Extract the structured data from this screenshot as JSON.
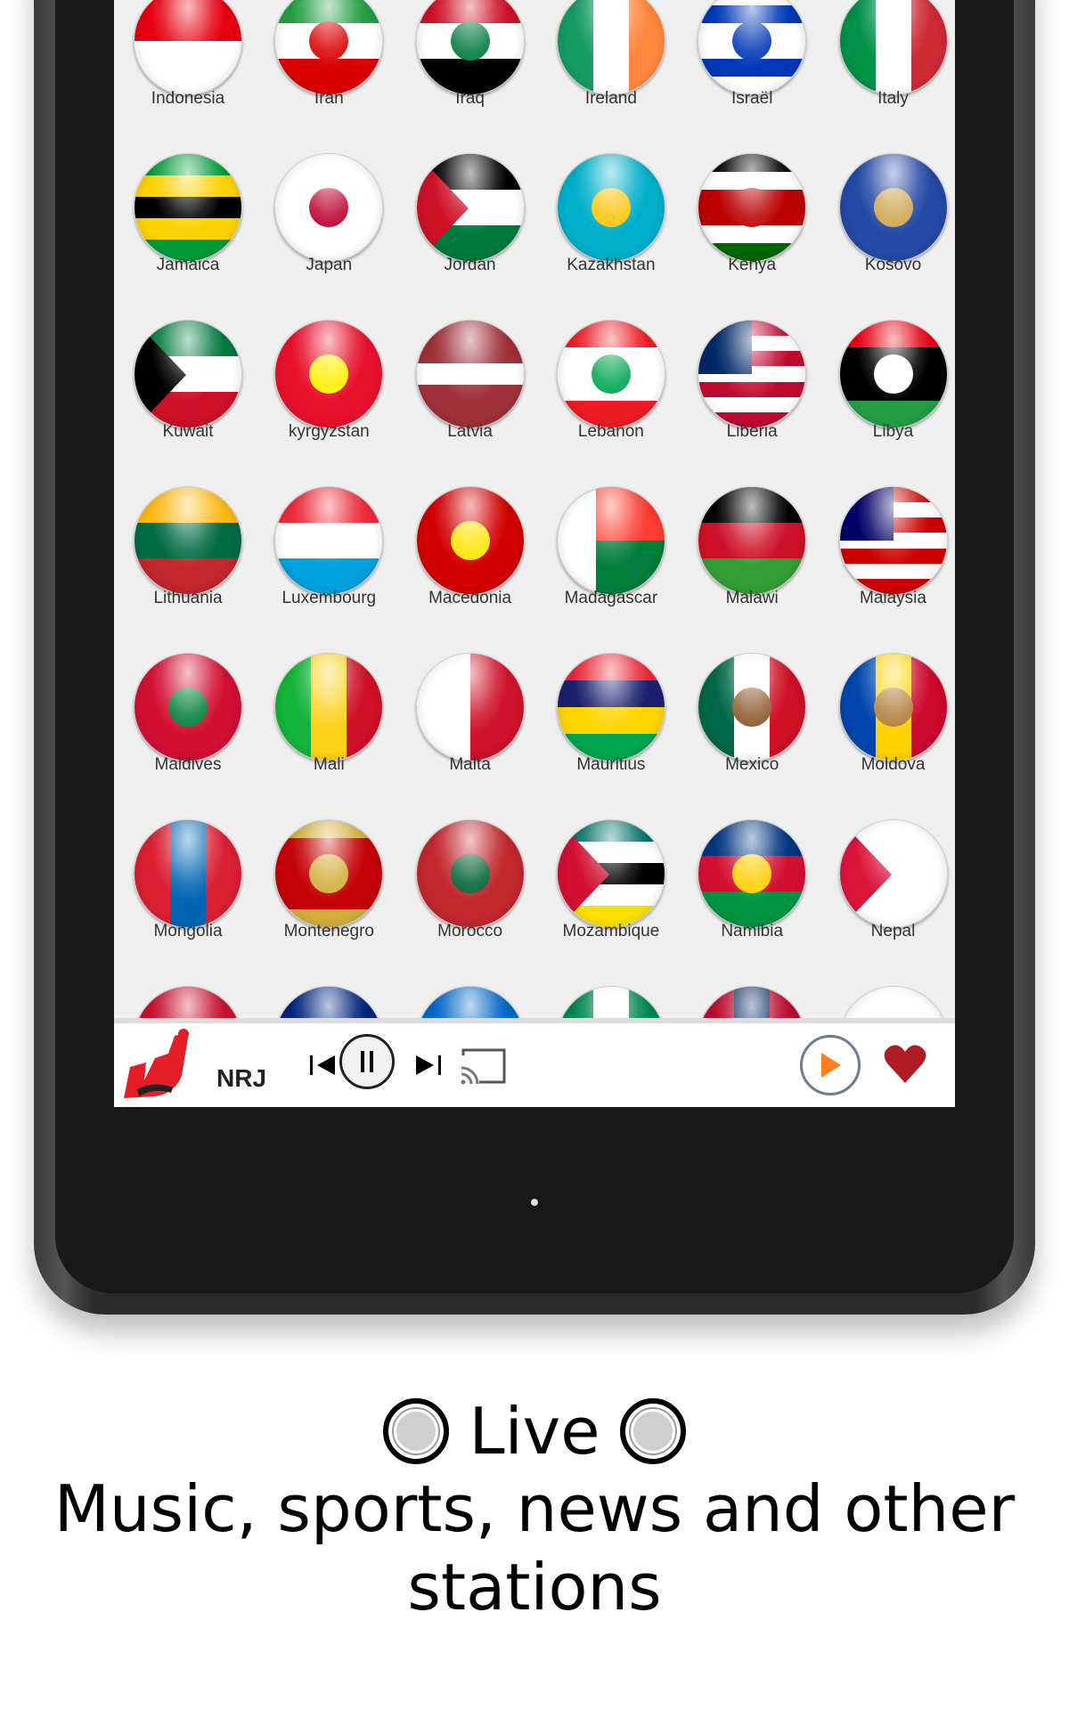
{
  "countries": [
    {
      "name": "Indonesia",
      "dir": "column",
      "stripes": [
        "#e70011",
        "#ffffff"
      ]
    },
    {
      "name": "Iran",
      "dir": "column",
      "stripes": [
        "#239f40",
        "#ffffff",
        "#da0000"
      ],
      "emblem": "#da0000"
    },
    {
      "name": "Iraq",
      "dir": "column",
      "stripes": [
        "#ce1126",
        "#ffffff",
        "#000000"
      ],
      "emblem": "#007a3d"
    },
    {
      "name": "Ireland",
      "dir": "row",
      "stripes": [
        "#169b62",
        "#ffffff",
        "#ff883e"
      ]
    },
    {
      "name": "Israël",
      "dir": "column",
      "stripes": [
        "#ffffff",
        "#0038b8",
        "#ffffff",
        "#ffffff",
        "#0038b8",
        "#ffffff"
      ],
      "emblem": "#0038b8"
    },
    {
      "name": "Italy",
      "dir": "row",
      "stripes": [
        "#009246",
        "#ffffff",
        "#ce2b37"
      ]
    },
    {
      "name": "Jamaica",
      "dir": "column",
      "stripes": [
        "#009b3a",
        "#fed100",
        "#000000",
        "#fed100",
        "#009b3a"
      ]
    },
    {
      "name": "Japan",
      "dir": "column",
      "stripes": [
        "#ffffff"
      ],
      "emblem": "#bc002d"
    },
    {
      "name": "Jordan",
      "dir": "column",
      "stripes": [
        "#000000",
        "#ffffff",
        "#007a3d"
      ],
      "tri": "#ce1126"
    },
    {
      "name": "Kazakhstan",
      "dir": "column",
      "stripes": [
        "#00afca"
      ],
      "emblem": "#fec50c"
    },
    {
      "name": "Kenya",
      "dir": "column",
      "stripes": [
        "#000000",
        "#ffffff",
        "#bb0000",
        "#bb0000",
        "#ffffff",
        "#006600"
      ],
      "emblem": "#bb0000"
    },
    {
      "name": "Kosovo",
      "dir": "column",
      "stripes": [
        "#244aa5"
      ],
      "emblem": "#d0a650"
    },
    {
      "name": "Kuwait",
      "dir": "column",
      "stripes": [
        "#007a3d",
        "#ffffff",
        "#ce1126"
      ],
      "tri": "#000000"
    },
    {
      "name": "kyrgyzstan",
      "dir": "column",
      "stripes": [
        "#e8112d"
      ],
      "emblem": "#ffef00"
    },
    {
      "name": "Latvia",
      "dir": "column",
      "stripes": [
        "#9e3039",
        "#9e3039",
        "#ffffff",
        "#9e3039",
        "#9e3039"
      ]
    },
    {
      "name": "Lebanon",
      "dir": "column",
      "stripes": [
        "#ed1c24",
        "#ffffff",
        "#ffffff",
        "#ed1c24"
      ],
      "emblem": "#00a651"
    },
    {
      "name": "Liberia",
      "dir": "column",
      "stripes": [
        "#bf0a30",
        "#ffffff",
        "#bf0a30",
        "#ffffff",
        "#bf0a30",
        "#ffffff",
        "#bf0a30"
      ],
      "canton": "#002868"
    },
    {
      "name": "Libya",
      "dir": "column",
      "stripes": [
        "#e70013",
        "#000000",
        "#000000",
        "#239e46"
      ],
      "emblem": "#ffffff"
    },
    {
      "name": "Lithuania",
      "dir": "column",
      "stripes": [
        "#fdb913",
        "#006a44",
        "#c1272d"
      ]
    },
    {
      "name": "Luxembourg",
      "dir": "column",
      "stripes": [
        "#ed2939",
        "#ffffff",
        "#00a1de"
      ]
    },
    {
      "name": "Macedonia",
      "dir": "column",
      "stripes": [
        "#d20000"
      ],
      "emblem": "#ffe600"
    },
    {
      "name": "Madagascar",
      "dir": "column",
      "stripes": [
        "#fc3d32",
        "#007e3a"
      ],
      "hoist": "#ffffff"
    },
    {
      "name": "Malawi",
      "dir": "column",
      "stripes": [
        "#000000",
        "#ce1126",
        "#339e35"
      ]
    },
    {
      "name": "Malaysia",
      "dir": "column",
      "stripes": [
        "#cc0001",
        "#ffffff",
        "#cc0001",
        "#ffffff",
        "#cc0001",
        "#ffffff",
        "#cc0001"
      ],
      "canton": "#010066"
    },
    {
      "name": "Maldives",
      "dir": "column",
      "stripes": [
        "#d21034"
      ],
      "emblem": "#007e3a"
    },
    {
      "name": "Mali",
      "dir": "row",
      "stripes": [
        "#14b53a",
        "#fcd116",
        "#ce1126"
      ]
    },
    {
      "name": "Malta",
      "dir": "row",
      "stripes": [
        "#ffffff",
        "#cf142b"
      ]
    },
    {
      "name": "Mauritius",
      "dir": "column",
      "stripes": [
        "#ea2839",
        "#1a206d",
        "#ffd500",
        "#00a551"
      ]
    },
    {
      "name": "Mexico",
      "dir": "row",
      "stripes": [
        "#006847",
        "#ffffff",
        "#ce1126"
      ],
      "emblem": "#8b5a2b"
    },
    {
      "name": "Moldova",
      "dir": "row",
      "stripes": [
        "#0046ae",
        "#ffd200",
        "#cc092f"
      ],
      "emblem": "#b07e3a"
    },
    {
      "name": "Mongolia",
      "dir": "row",
      "stripes": [
        "#da2032",
        "#0066b3",
        "#da2032"
      ]
    },
    {
      "name": "Montenegro",
      "dir": "column",
      "stripes": [
        "#d3ae3b",
        "#c40308",
        "#c40308",
        "#c40308",
        "#c40308",
        "#d3ae3b"
      ],
      "emblem": "#d3ae3b"
    },
    {
      "name": "Morocco",
      "dir": "column",
      "stripes": [
        "#c1272d"
      ],
      "emblem": "#006233"
    },
    {
      "name": "Mozambique",
      "dir": "column",
      "stripes": [
        "#007168",
        "#ffffff",
        "#000000",
        "#ffffff",
        "#fce100"
      ],
      "tri": "#d21034"
    },
    {
      "name": "Namibia",
      "dir": "column",
      "stripes": [
        "#003580",
        "#d21034",
        "#009543"
      ],
      "emblem": "#ffce00"
    },
    {
      "name": "Nepal",
      "dir": "column",
      "stripes": [
        "#ffffff"
      ],
      "tri": "#dc143c"
    }
  ],
  "partial_row": [
    {
      "dir": "column",
      "stripes": [
        "#c8102e",
        "#ffffff"
      ]
    },
    {
      "dir": "column",
      "stripes": [
        "#00247d",
        "#00247d"
      ]
    },
    {
      "dir": "column",
      "stripes": [
        "#0067c6",
        "#ffffff",
        "#0067c6"
      ]
    },
    {
      "dir": "row",
      "stripes": [
        "#008751",
        "#ffffff",
        "#008751"
      ]
    },
    {
      "dir": "row",
      "stripes": [
        "#ba0c2f",
        "#00205b",
        "#ba0c2f"
      ]
    },
    {
      "dir": "column",
      "stripes": [
        "#ffffff",
        "#ffffff"
      ]
    }
  ],
  "player": {
    "station_name": "NRJ",
    "logo_text": "NRJ",
    "controls": [
      "skip-previous",
      "pause",
      "skip-next",
      "cast",
      "play",
      "favorite"
    ],
    "accent": "#ff7f1e",
    "heart_color": "#b01c24"
  },
  "caption": {
    "live": "Live",
    "tagline": "Music, sports, news and other stations"
  }
}
